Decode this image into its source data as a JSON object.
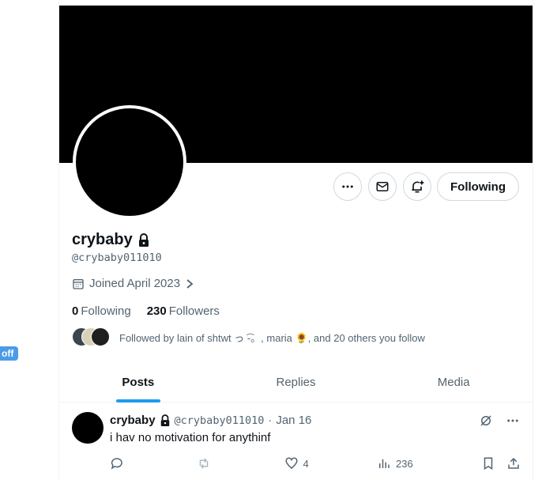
{
  "overlay": {
    "off_label": "off"
  },
  "profile": {
    "name": "crybaby",
    "handle": "@crybaby011010",
    "joined": "Joined April 2023",
    "following_count": "0",
    "following_label": "Following",
    "followers_count": "230",
    "followers_label": "Followers",
    "followed_by": "Followed by lain of shtwt っ ͡-。, maria 🌻, and 20 others you follow"
  },
  "actions": {
    "follow_button": "Following"
  },
  "tabs": [
    {
      "label": "Posts",
      "active": true
    },
    {
      "label": "Replies",
      "active": false
    },
    {
      "label": "Media",
      "active": false
    }
  ],
  "post": {
    "author": "crybaby",
    "handle": "@crybaby011010",
    "separator": "·",
    "date": "Jan 16",
    "text": "i hav no motivation for anythinf",
    "replies": "",
    "reposts": "",
    "likes": "4",
    "views": "236"
  },
  "colors": {
    "accent": "#1d9bf0",
    "muted": "#536471",
    "banner": "#000000"
  }
}
